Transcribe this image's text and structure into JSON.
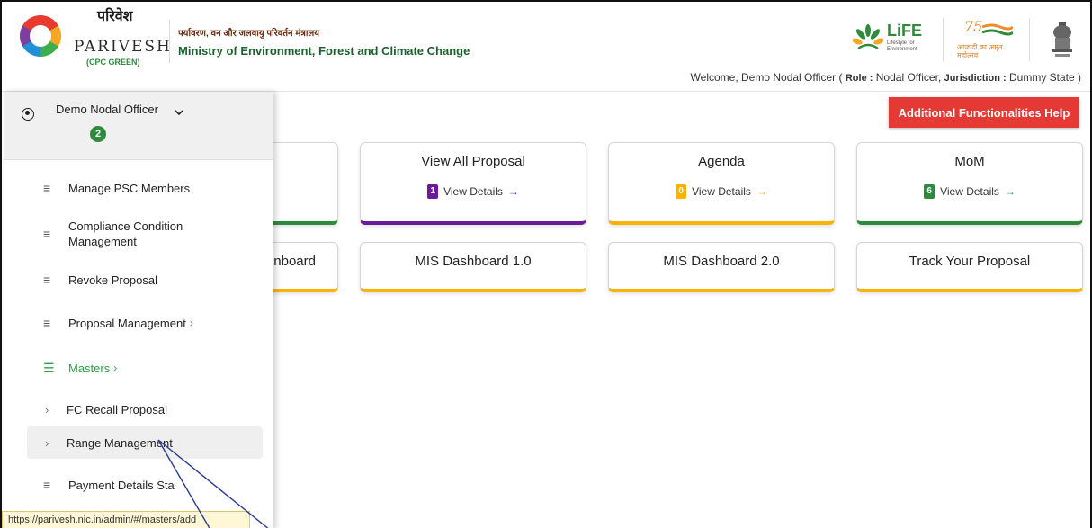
{
  "header": {
    "logo_hindi": "परिवेश",
    "logo_name": "PARIVESH",
    "logo_sub": "(CPC GREEN)",
    "ministry_hindi": "पर्यावरण, वन और जलवायु परिवर्तन मंत्रालय",
    "ministry_en": "Ministry of Environment, Forest and Climate Change",
    "life_text": "LiFE",
    "life_tag": "Lifestyle for Environment",
    "azadi_75": "75",
    "azadi_text": "आज़ादी का अमृत महोत्सव",
    "welcome_prefix": "Welcome, Demo Nodal Officer (",
    "role_label": "Role :",
    "role_value": "Nodal Officer,",
    "jurisdiction_label": "Jurisdiction :",
    "jurisdiction_value": "Dummy State )"
  },
  "help_button": "Additional Functionalities Help",
  "cards": [
    {
      "title": "View All Proposal",
      "count": "1",
      "details": "View Details",
      "arrow": "→",
      "color": "#6a1b9a"
    },
    {
      "title": "Agenda",
      "count": "0",
      "details": "View Details",
      "arrow": "→",
      "color": "#f9b208"
    },
    {
      "title": "MoM",
      "count": "6",
      "details": "View Details",
      "arrow": "→",
      "color": "#2e8b3e"
    }
  ],
  "dashboards": [
    {
      "title": "nboard"
    },
    {
      "title": "MIS Dashboard 1.0"
    },
    {
      "title": "MIS Dashboard 2.0"
    },
    {
      "title": "Track Your Proposal"
    }
  ],
  "sidebar": {
    "user_name": "Demo Nodal Officer",
    "badge_count": "2",
    "items": [
      {
        "label": "Manage PSC Members",
        "icon": "menu-icon"
      },
      {
        "label": "Compliance Condition Management",
        "icon": "menu-icon"
      },
      {
        "label": "Revoke Proposal",
        "icon": "menu-icon"
      },
      {
        "label": "Proposal Management",
        "icon": "menu-icon",
        "chevron": "›"
      },
      {
        "label": "Masters",
        "icon": "list-icon",
        "chevron": "›",
        "active_color": "#2e9e48"
      }
    ],
    "subitems": [
      {
        "label": "FC Recall Proposal",
        "chevron": "›"
      },
      {
        "label": "Range Management",
        "chevron": "›"
      }
    ],
    "last_item": "Payment Details Sta"
  },
  "status_url": "https://parivesh.nic.in/admin/#/masters/add"
}
